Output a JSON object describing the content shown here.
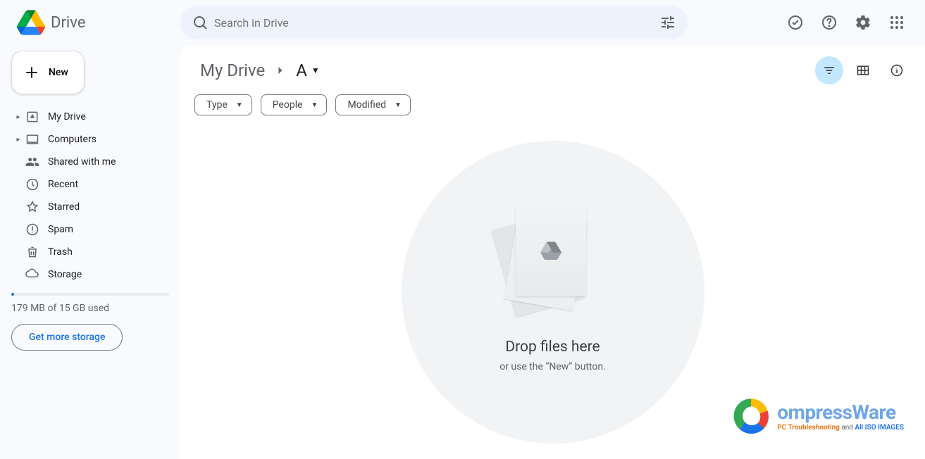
{
  "app": {
    "name": "Drive"
  },
  "search": {
    "placeholder": "Search in Drive"
  },
  "new_button": {
    "label": "New"
  },
  "sidebar": {
    "items": [
      {
        "label": "My Drive",
        "expandable": true
      },
      {
        "label": "Computers",
        "expandable": true
      },
      {
        "label": "Shared with me",
        "expandable": false
      },
      {
        "label": "Recent",
        "expandable": false
      },
      {
        "label": "Starred",
        "expandable": false
      },
      {
        "label": "Spam",
        "expandable": false
      },
      {
        "label": "Trash",
        "expandable": false
      },
      {
        "label": "Storage",
        "expandable": false
      }
    ],
    "storage_text": "179 MB of 15 GB used",
    "storage_percent": 1.2,
    "get_more_label": "Get more storage"
  },
  "breadcrumb": {
    "root": "My Drive",
    "current": "A"
  },
  "filters": {
    "type": "Type",
    "people": "People",
    "modified": "Modified"
  },
  "empty_state": {
    "title": "Drop files here",
    "subtitle": "or use the “New” button."
  },
  "watermark": {
    "brand": "ompressWare",
    "sub_orange": "PC Troubleshooting",
    "sub_grey": " and ",
    "sub_blue": "All ISO IMAGES"
  }
}
